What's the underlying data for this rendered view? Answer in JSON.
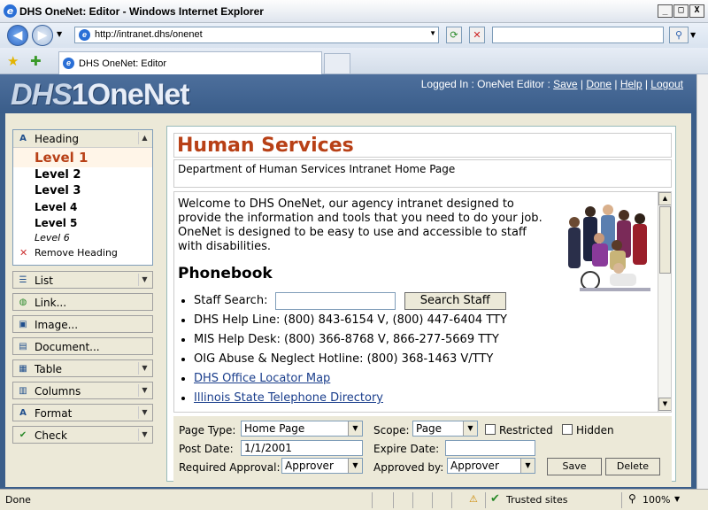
{
  "window": {
    "title": "DHS OneNet: Editor - Windows Internet Explorer",
    "minimize": "_",
    "maximize": "□",
    "close": "X"
  },
  "address_bar": {
    "url": "http://intranet.dhs/onenet",
    "search_value": ""
  },
  "tab": {
    "label": "DHS OneNet: Editor"
  },
  "site": {
    "logo_prefix": "DHS",
    "logo_main": "1OneNet",
    "logged_in_text": "Logged In : OneNet Editor :",
    "links": [
      "Save",
      "Done",
      "Help",
      "Logout"
    ]
  },
  "sidebar": {
    "heading": {
      "label": "Heading",
      "levels": [
        "Level 1",
        "Level 2",
        "Level 3",
        "Level 4",
        "Level 5",
        "Level 6"
      ],
      "remove": "Remove Heading"
    },
    "items": [
      {
        "label": "List",
        "icon": "list-icon",
        "dropdown": true
      },
      {
        "label": "Link...",
        "icon": "globe-link-icon",
        "dropdown": false
      },
      {
        "label": "Image...",
        "icon": "image-icon",
        "dropdown": false
      },
      {
        "label": "Document...",
        "icon": "document-icon",
        "dropdown": false
      },
      {
        "label": "Table",
        "icon": "table-icon",
        "dropdown": true
      },
      {
        "label": "Columns",
        "icon": "columns-icon",
        "dropdown": true
      },
      {
        "label": "Format",
        "icon": "format-icon",
        "dropdown": true
      },
      {
        "label": "Check",
        "icon": "check-icon",
        "dropdown": true
      }
    ]
  },
  "main": {
    "title": "Human Services",
    "subtitle": "Department of Human Services Intranet Home Page",
    "welcome": "Welcome to DHS OneNet, our agency intranet designed to provide the information and tools that you need to do your job. OneNet is designed to be easy to use and accessible to staff with disabilities.",
    "phonebook_heading": "Phonebook",
    "staff_search_label": "Staff Search:",
    "staff_search_value": "",
    "staff_search_button": "Search Staff",
    "lines": [
      "DHS Help Line: (800) 843-6154 V, (800) 447-6404 TTY",
      "MIS Help Desk: (800) 366-8768 V, 866-277-5669 TTY",
      "OIG Abuse & Neglect Hotline: (800) 368-1463 V/TTY"
    ],
    "links": [
      "DHS Office Locator Map",
      "Illinois State Telephone Directory"
    ]
  },
  "form": {
    "page_type_label": "Page Type:",
    "page_type_value": "Home Page",
    "scope_label": "Scope:",
    "scope_value": "Page",
    "restricted_label": "Restricted",
    "hidden_label": "Hidden",
    "post_date_label": "Post Date:",
    "post_date_value": "1/1/2001",
    "expire_date_label": "Expire Date:",
    "expire_date_value": "",
    "required_approval_label": "Required Approval:",
    "required_approval_value": "Approver",
    "approved_by_label": "Approved by:",
    "approved_by_value": "Approver",
    "save_button": "Save",
    "delete_button": "Delete"
  },
  "status_bar": {
    "text": "Done",
    "zone": "Trusted sites",
    "zoom": "100%"
  },
  "colors": {
    "accent_heading": "#b84016",
    "header_bg": "#3b5e8a",
    "link": "#1a3e8c"
  }
}
